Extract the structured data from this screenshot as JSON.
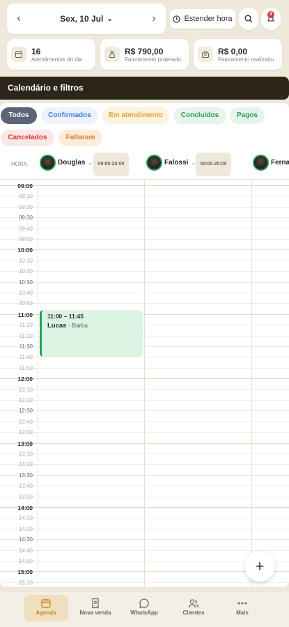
{
  "header": {
    "date_label": "Sex, 10 Jul",
    "extend_label": "Estender hora",
    "notification_count": "3"
  },
  "stats": [
    {
      "value": "16",
      "label": "Atendimentos do dia",
      "icon": "calendar-icon"
    },
    {
      "value": "R$ 790,00",
      "label": "Faturamento projetado",
      "icon": "money-bag-icon"
    },
    {
      "value": "R$ 0,00",
      "label": "Faturamento realizado",
      "icon": "register-icon"
    }
  ],
  "filter_bar_title": "Calendário e filtros",
  "chips": [
    {
      "label": "Todos",
      "color": "#ffffff",
      "bg": "#5c6477"
    },
    {
      "label": "Confirmados",
      "color": "#3c7be0",
      "bg": "#eef2fb"
    },
    {
      "label": "Em atendimento",
      "color": "#e3a22e",
      "bg": "#fdf2e0"
    },
    {
      "label": "Concluídos",
      "color": "#1fa054",
      "bg": "#e6f5ec"
    },
    {
      "label": "Pagos",
      "color": "#1fa054",
      "bg": "#e6f5ec"
    },
    {
      "label": "Cancelados",
      "color": "#d23b3b",
      "bg": "#fbe8e6"
    },
    {
      "label": "Faltaram",
      "color": "#d9822b",
      "bg": "#fbecdc"
    }
  ],
  "schedule": {
    "hora_label": "HORA",
    "professionals": [
      {
        "name": "Douglas",
        "hours": "09:00-20:00"
      },
      {
        "name": "Falossi",
        "hours": "09:00-20:00"
      },
      {
        "name": "Ferna"
      }
    ],
    "times": [
      "09:00",
      "09:10",
      "09:20",
      "09:30",
      "09:40",
      "09:50",
      "10:00",
      "10:10",
      "10:20",
      "10:30",
      "10:40",
      "10:50",
      "11:00",
      "11:10",
      "11:20",
      "11:30",
      "11:40",
      "11:50",
      "12:00",
      "12:10",
      "12:20",
      "12:30",
      "12:40",
      "12:50",
      "13:00",
      "13:10",
      "13:20",
      "13:30",
      "13:40",
      "13:50",
      "14:00",
      "14:10",
      "14:20",
      "14:30",
      "14:40",
      "14:50",
      "15:00",
      "15:10"
    ],
    "appointment": {
      "time": "11:00 – 11:45",
      "client": "Lucas",
      "service": "Barba"
    }
  },
  "fab_label": "+",
  "nav": [
    {
      "label": "Agenda",
      "icon": "calendar-icon",
      "active": true
    },
    {
      "label": "Nova venda",
      "icon": "receipt-icon"
    },
    {
      "label": "WhatsApp",
      "icon": "chat-icon"
    },
    {
      "label": "Clientes",
      "icon": "users-icon"
    },
    {
      "label": "Mais",
      "icon": "more-icon"
    }
  ]
}
